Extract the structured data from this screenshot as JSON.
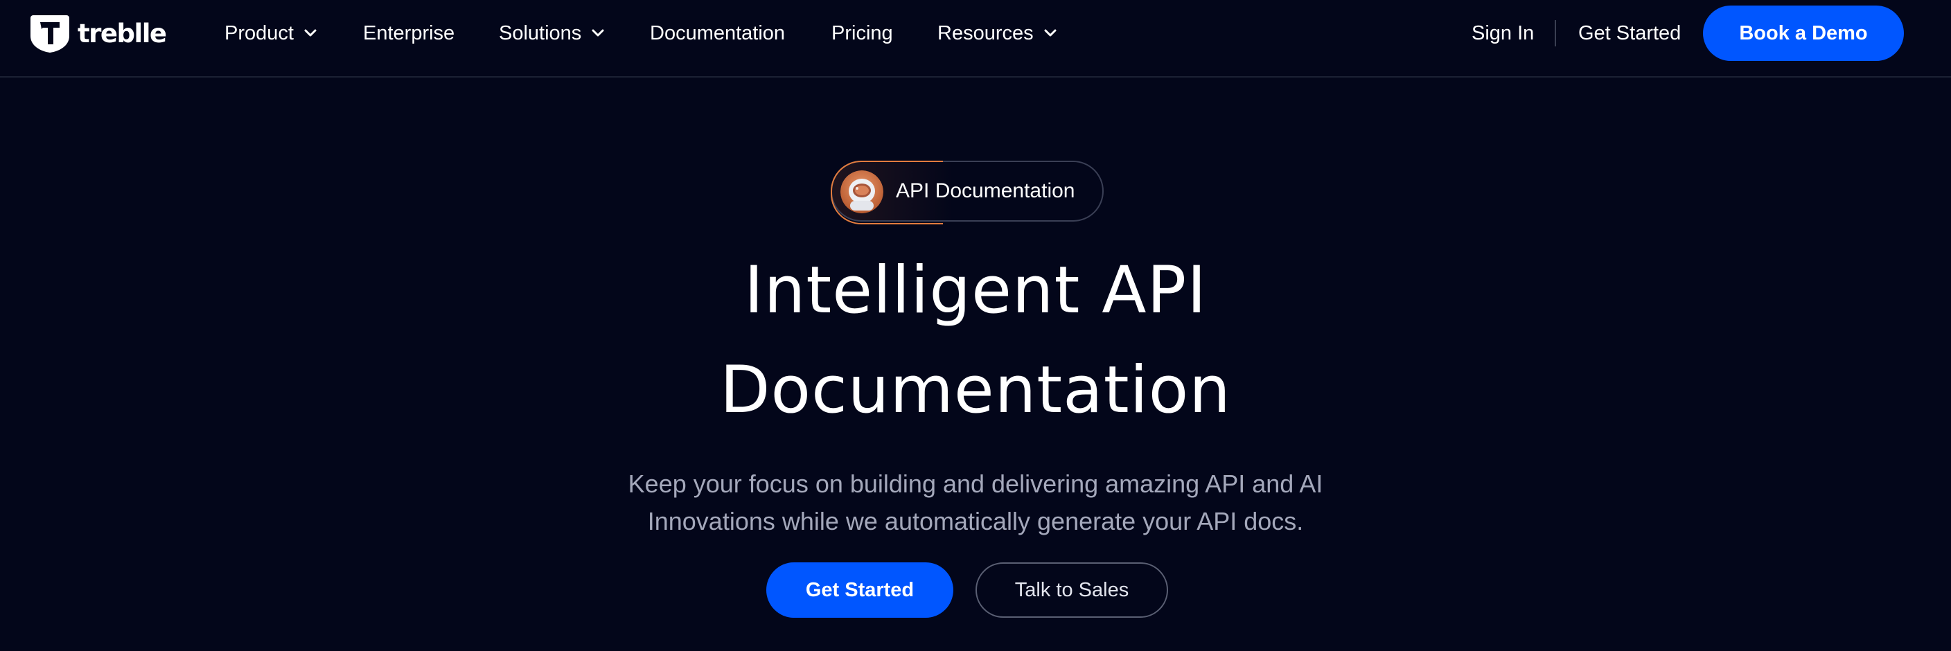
{
  "brand": {
    "name": "treblle"
  },
  "nav": {
    "items": [
      {
        "label": "Product",
        "has_dropdown": true
      },
      {
        "label": "Enterprise",
        "has_dropdown": false
      },
      {
        "label": "Solutions",
        "has_dropdown": true
      },
      {
        "label": "Documentation",
        "has_dropdown": false
      },
      {
        "label": "Pricing",
        "has_dropdown": false
      },
      {
        "label": "Resources",
        "has_dropdown": true
      }
    ],
    "sign_in": "Sign In",
    "get_started": "Get Started",
    "book_demo": "Book a Demo"
  },
  "hero": {
    "badge_label": "API Documentation",
    "title_lines": [
      "Intelligent API",
      "Documentation"
    ],
    "subtitle_lines": [
      "Keep your focus on building and delivering amazing API and AI",
      "Innovations while we automatically generate your API docs."
    ],
    "primary_cta": "Get Started",
    "secondary_cta": "Talk to Sales"
  },
  "colors": {
    "background": "#03061a",
    "accent": "#0056ff",
    "badge_border_accent": "#e27c3e",
    "subtitle": "#a4a8bb"
  },
  "icons": {
    "logo": "treblle-logo-icon",
    "dropdown": "chevron-down-icon",
    "badge_avatar": "astronaut-avatar-icon"
  }
}
